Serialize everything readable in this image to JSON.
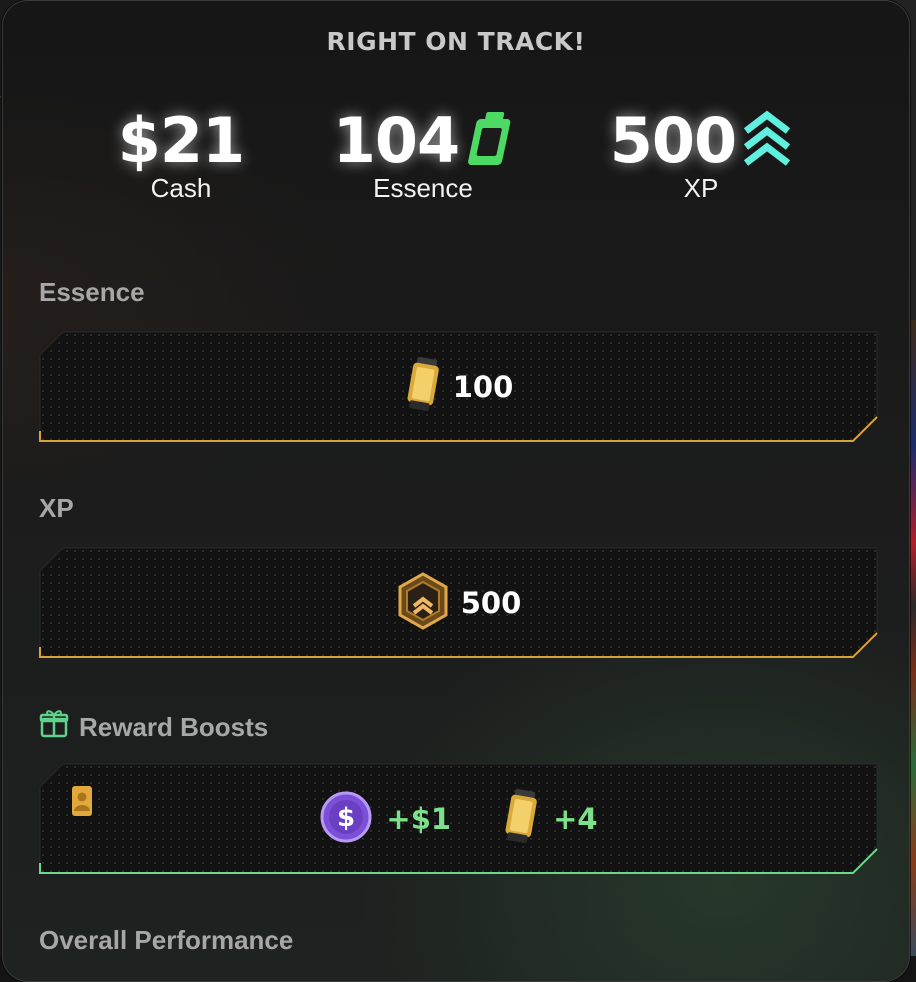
{
  "header": {
    "title": "RIGHT ON TRACK!"
  },
  "stats": [
    {
      "value": "$21",
      "label": "Cash",
      "icon": "none"
    },
    {
      "value": "104",
      "label": "Essence",
      "icon": "essence-battery-icon",
      "icon_color": "#4cd964"
    },
    {
      "value": "500",
      "label": "XP",
      "icon": "xp-chevrons-icon",
      "icon_color": "#5ff0e0"
    }
  ],
  "sections": {
    "essence": {
      "title": "Essence",
      "amount": "100",
      "icon": "essence-canister-icon",
      "accent": "#d8a23a"
    },
    "xp": {
      "title": "XP",
      "amount": "500",
      "icon": "xp-badge-icon",
      "accent": "#d8a23a"
    },
    "boosts": {
      "title": "Reward Boosts",
      "icon": "gift-box-icon",
      "cash_boost": "+$1",
      "essence_boost": "+4",
      "accent": "#6fd58a"
    },
    "performance": {
      "title": "Overall Performance"
    }
  }
}
